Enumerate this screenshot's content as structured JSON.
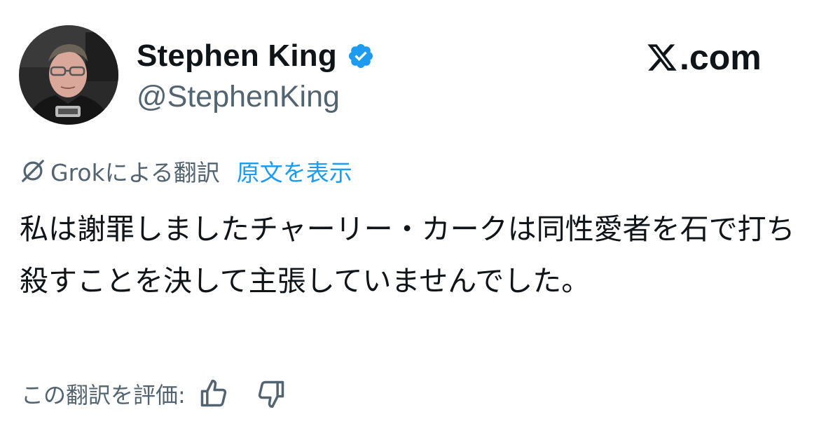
{
  "author": {
    "display_name": "Stephen King",
    "handle": "@StephenKing",
    "verified": true,
    "avatar_icon": "profile-photo"
  },
  "brand": {
    "site_text": ".com",
    "logo_icon": "x-logo-icon"
  },
  "translation": {
    "icon": "grok-icon",
    "translated_by": "Grokによる翻訳",
    "show_original": "原文を表示"
  },
  "tweet": {
    "text": " 私は謝罪しましたチャーリー・カークは同性愛者を石で打ち殺すことを決して主張していませんでした。"
  },
  "rating": {
    "label": "この翻訳を評価:",
    "thumbs_up_icon": "thumbs-up-icon",
    "thumbs_down_icon": "thumbs-down-icon"
  },
  "colors": {
    "text_primary": "#0f1419",
    "text_secondary": "#536471",
    "link": "#1d9bf0",
    "verified": "#1d9bf0"
  }
}
